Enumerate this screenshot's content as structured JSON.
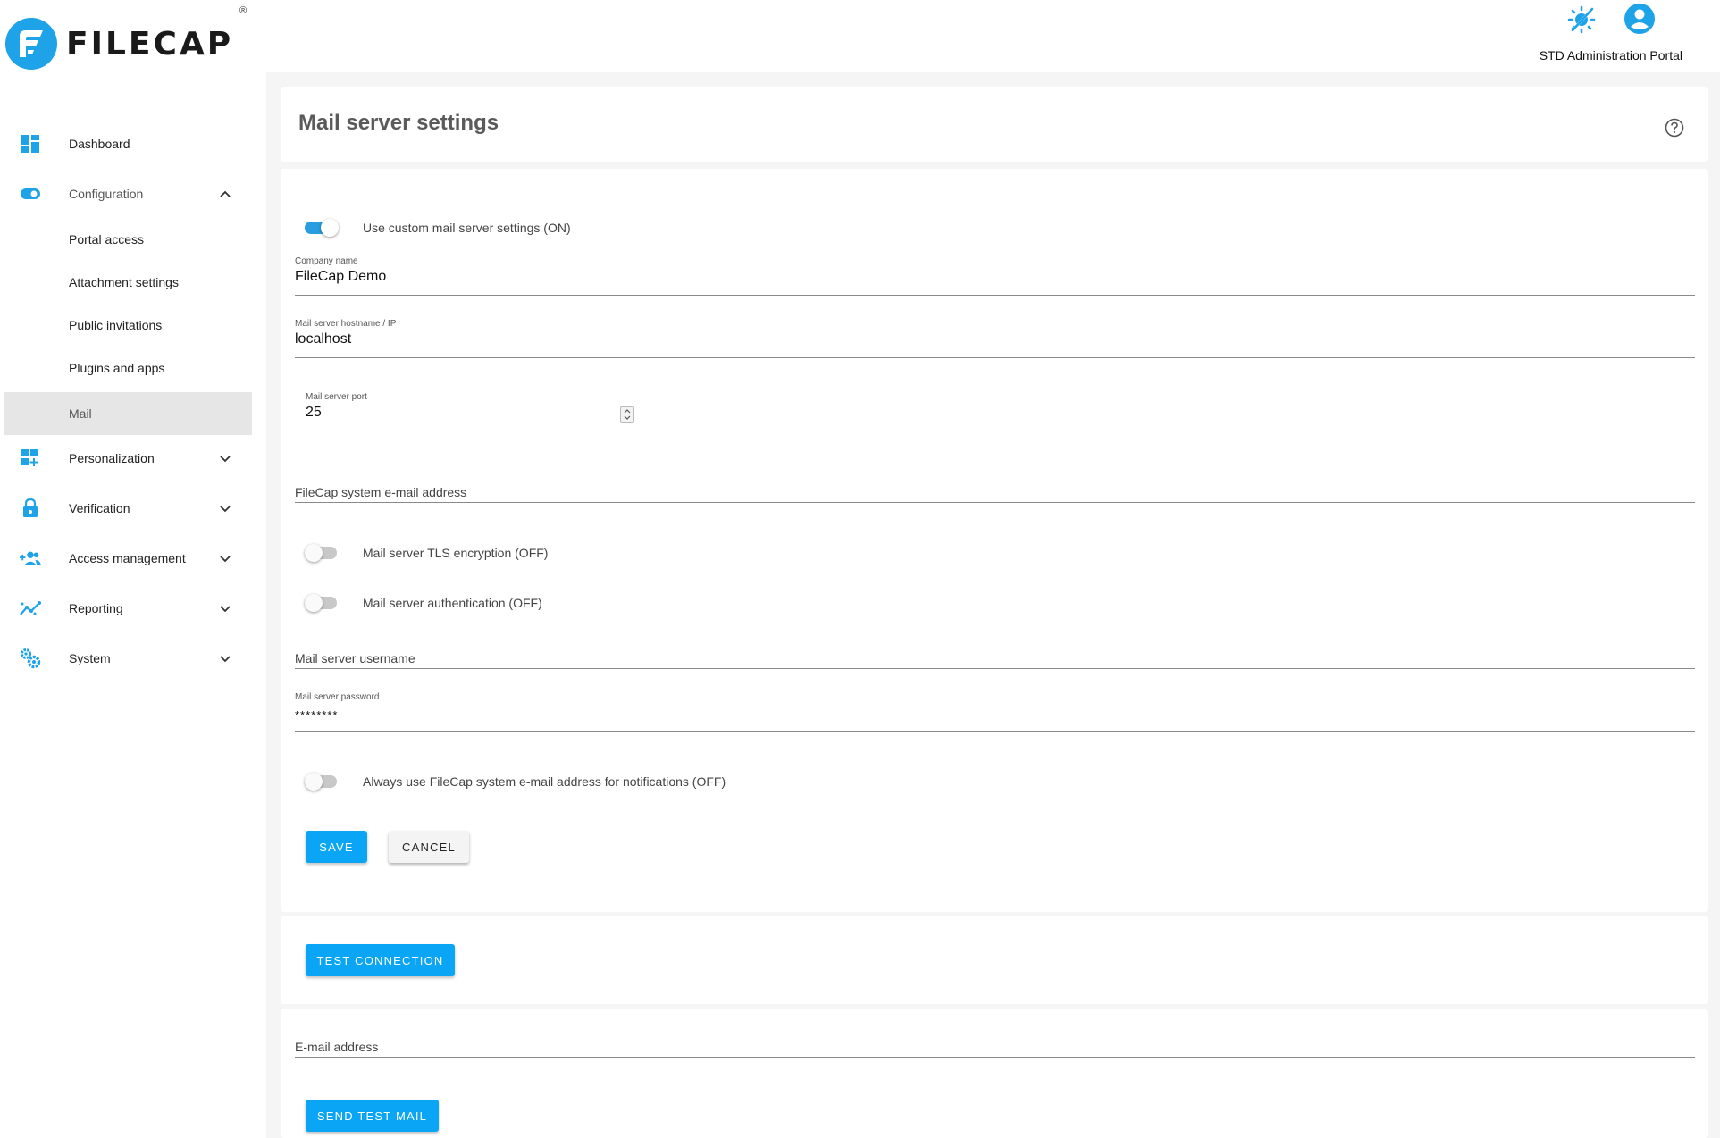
{
  "brand": {
    "name": "FILECAP",
    "registered": "®",
    "accent_color": "#0aa6f5",
    "logo_color": "#1ea2e8"
  },
  "header": {
    "portal_label": "STD Administration Portal",
    "theme_icon": "theme-toggle-icon",
    "user_icon": "account-circle-icon"
  },
  "sidebar": {
    "items": [
      {
        "label": "Dashboard",
        "icon": "dashboard-icon"
      },
      {
        "label": "Configuration",
        "icon": "toggle-icon",
        "expanded": true
      },
      {
        "label": "Personalization",
        "icon": "widgets-add-icon"
      },
      {
        "label": "Verification",
        "icon": "lock-icon"
      },
      {
        "label": "Access management",
        "icon": "people-add-icon"
      },
      {
        "label": "Reporting",
        "icon": "trending-icon"
      },
      {
        "label": "System",
        "icon": "settings-gears-icon"
      }
    ],
    "config_subitems": [
      {
        "label": "Portal access"
      },
      {
        "label": "Attachment settings"
      },
      {
        "label": "Public invitations"
      },
      {
        "label": "Plugins and apps"
      },
      {
        "label": "Mail",
        "active": true
      }
    ]
  },
  "page": {
    "title": "Mail server settings",
    "help_icon": "help-circle-icon"
  },
  "form": {
    "custom_settings_toggle": {
      "label": "Use custom mail server settings (ON)",
      "on": true
    },
    "company_name": {
      "label": "Company name",
      "value": "FileCap Demo"
    },
    "hostname": {
      "label": "Mail server hostname / IP",
      "value": "localhost"
    },
    "port": {
      "label": "Mail server port",
      "value": "25"
    },
    "system_email": {
      "placeholder": "FileCap system e-mail address"
    },
    "tls_toggle": {
      "label": "Mail server TLS encryption (OFF)",
      "on": false
    },
    "auth_toggle": {
      "label": "Mail server authentication (OFF)",
      "on": false
    },
    "username": {
      "placeholder": "Mail server username"
    },
    "password": {
      "label": "Mail server password",
      "value": "********"
    },
    "always_system_toggle": {
      "label": "Always use FileCap system e-mail address for notifications (OFF)",
      "on": false
    },
    "save_label": "SAVE",
    "cancel_label": "CANCEL"
  },
  "test": {
    "test_connection_label": "TEST CONNECTION",
    "email_placeholder": "E-mail address",
    "send_test_label": "SEND TEST MAIL"
  }
}
